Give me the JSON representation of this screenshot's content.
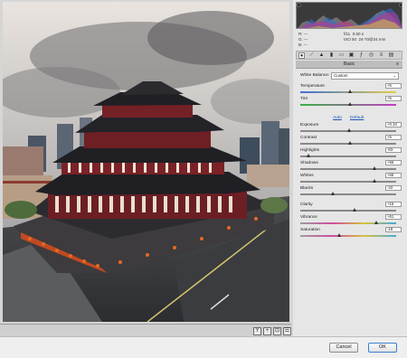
{
  "panel": {
    "camera_info": {
      "r": "R:",
      "g": "G:",
      "b": "B:",
      "r_val": "---",
      "g_val": "---",
      "b_val": "---",
      "aperture": "f/11",
      "shutter": "0.50 s",
      "iso": "ISO 50",
      "lens": "24-70@24 mm"
    },
    "section_title": "Basic",
    "white_balance": {
      "label": "White Balance:",
      "value": "Custom"
    },
    "links": {
      "auto": "Auto",
      "default": "Default"
    },
    "adjustments": [
      {
        "label": "Temperature",
        "value": "+5",
        "pos": 0.52
      },
      {
        "label": "Tint",
        "value": "+5",
        "pos": 0.52
      },
      {
        "label": "Exposure",
        "value": "+0.10",
        "pos": 0.51
      },
      {
        "label": "Contrast",
        "value": "+5",
        "pos": 0.52
      },
      {
        "label": "Highlights",
        "value": "-83",
        "pos": 0.085
      },
      {
        "label": "Shadows",
        "value": "+56",
        "pos": 0.78
      },
      {
        "label": "Whites",
        "value": "+55",
        "pos": 0.775
      },
      {
        "label": "Blacks",
        "value": "-32",
        "pos": 0.34
      },
      {
        "label": "Clarity",
        "value": "+15",
        "pos": 0.575
      },
      {
        "label": "Vibrance",
        "value": "+61",
        "pos": 0.8
      },
      {
        "label": "Saturation",
        "value": "-18",
        "pos": 0.41
      }
    ]
  },
  "footer": {
    "cancel_label": "Cancel",
    "ok_label": "OK"
  },
  "icons": {
    "view_toggle_1": "Y",
    "view_toggle_2": "+",
    "view_toggle_3": "⊡",
    "view_toggle_4": "☰"
  }
}
